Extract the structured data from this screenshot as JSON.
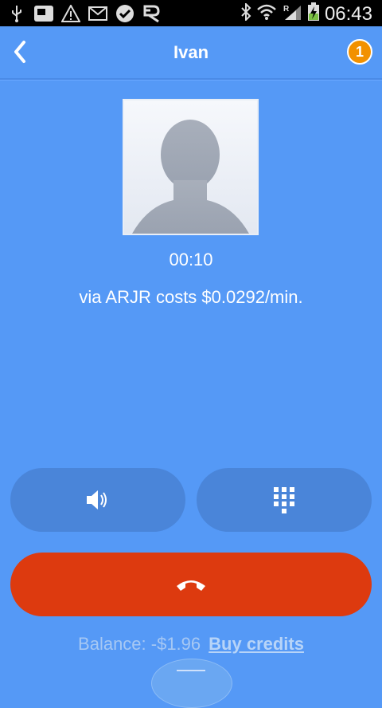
{
  "status_bar": {
    "time": "06:43",
    "left_icons": [
      "usb-icon",
      "screenshot-icon",
      "warning-icon",
      "mail-icon",
      "check-icon",
      "app-icon"
    ],
    "right_icons": [
      "bluetooth-icon",
      "wifi-icon",
      "signal-roaming-icon",
      "battery-charging-icon"
    ]
  },
  "header": {
    "title": "Ivan",
    "notification_count": "1"
  },
  "call": {
    "timer": "00:10",
    "rate_text": "via ARJR costs $0.0292/min."
  },
  "buttons": {
    "speaker_icon": "speaker-icon",
    "keypad_icon": "keypad-icon",
    "hangup_icon": "hangup-phone-icon"
  },
  "footer": {
    "balance_text": "Balance: -$1.96",
    "buy_credits_label": "Buy credits"
  },
  "colors": {
    "background": "#5599f6",
    "hangup": "#dd3a0f",
    "badge": "#f29100",
    "pill": "#4a85d9"
  }
}
